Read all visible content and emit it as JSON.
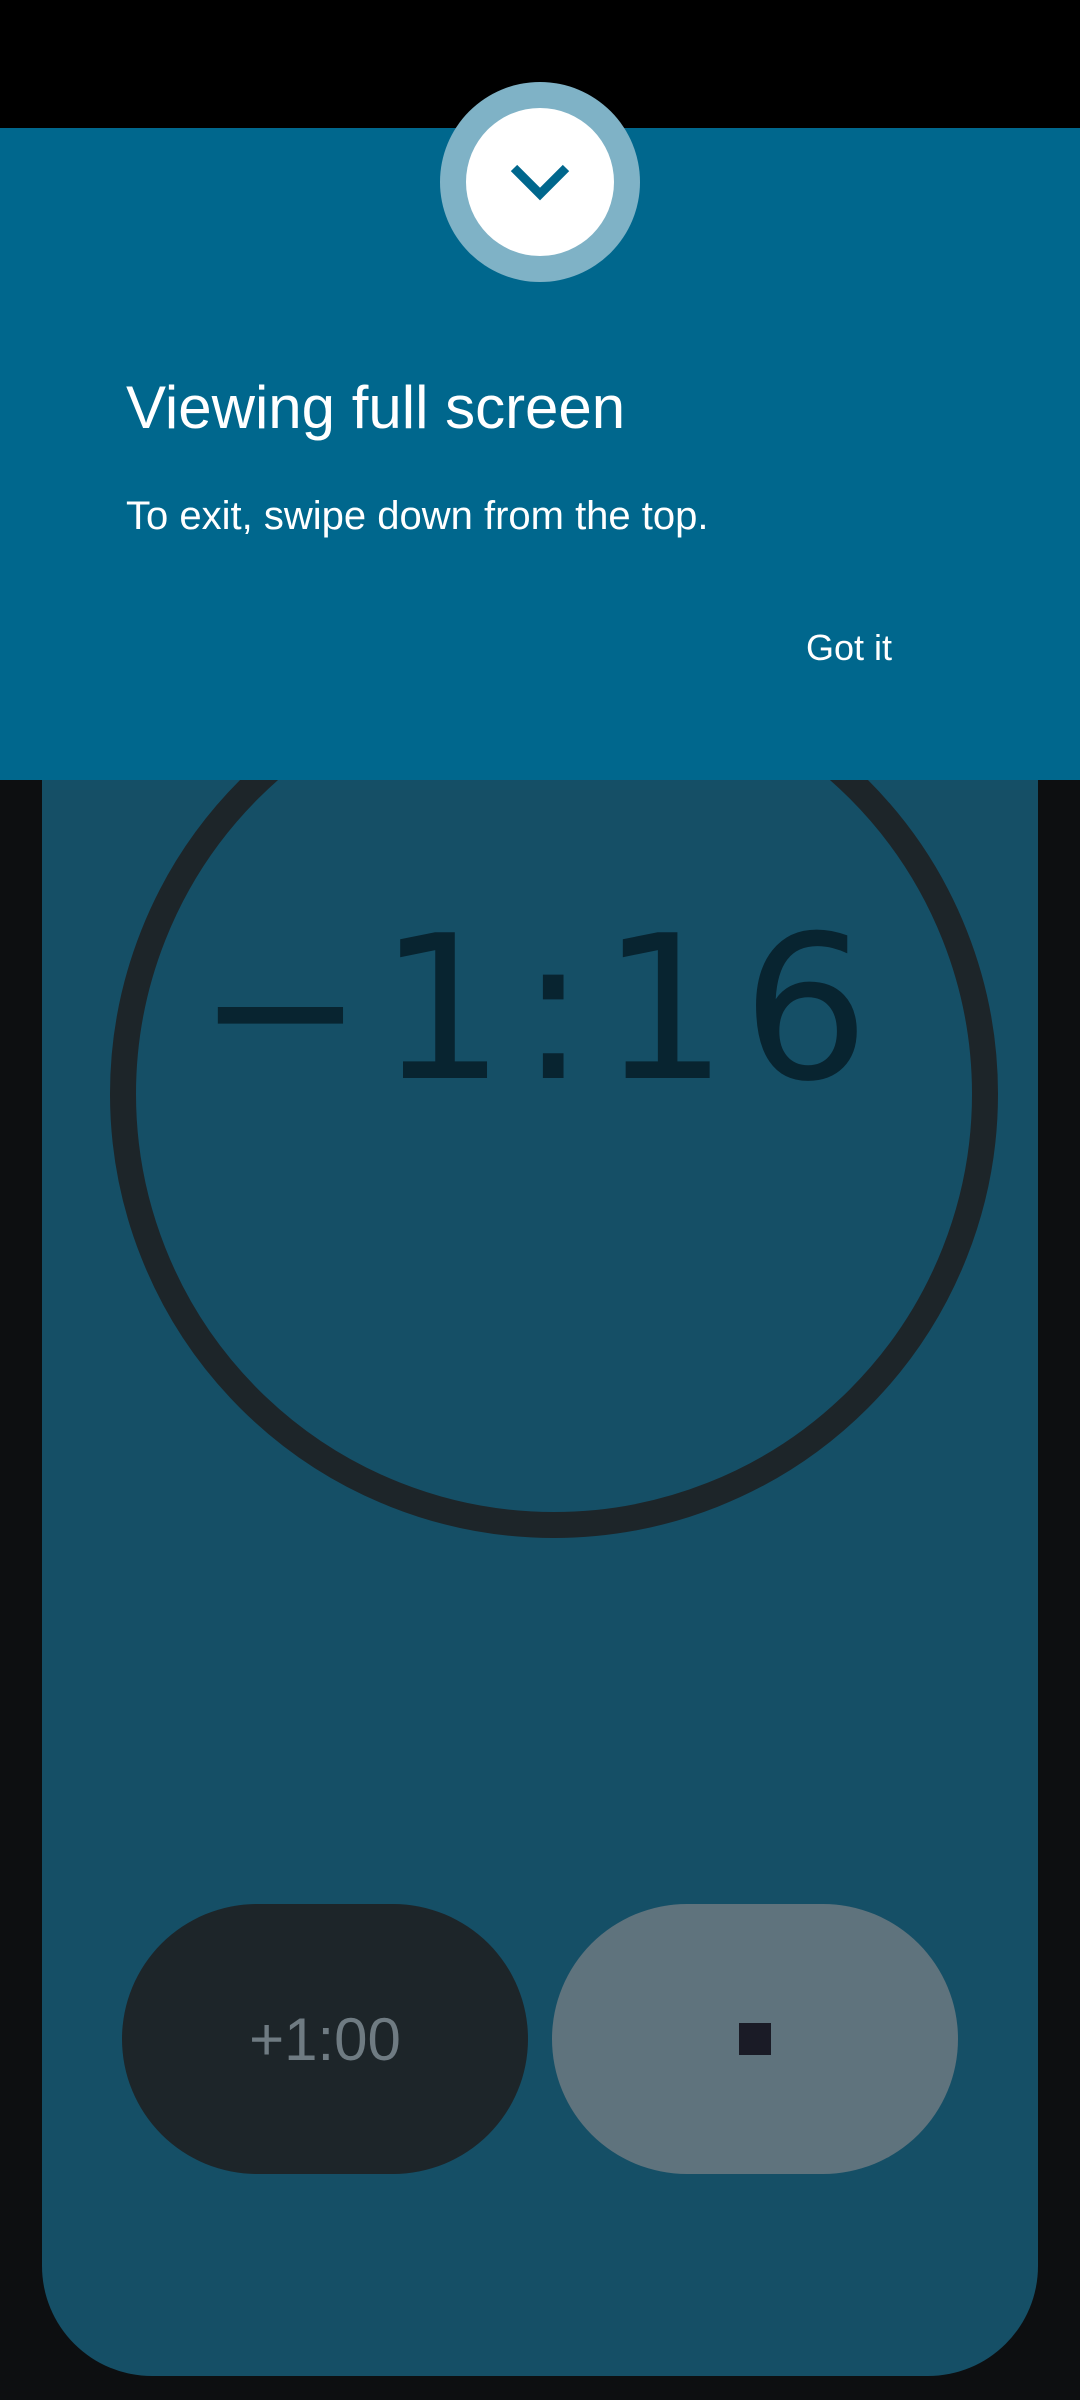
{
  "banner": {
    "title": "Viewing full screen",
    "message": "To exit, swipe down from the top.",
    "action_label": "Got it",
    "handle_icon": "chevron-down-icon"
  },
  "timer": {
    "display": "−1:16",
    "add_label": "+1:00",
    "stop_icon": "stop-icon"
  },
  "colors": {
    "banner_bg": "#00678d",
    "card_bg": "#154f66",
    "ring": "#1d2529",
    "add_button_bg": "#1d2529",
    "stop_button_bg": "#5f737d"
  }
}
